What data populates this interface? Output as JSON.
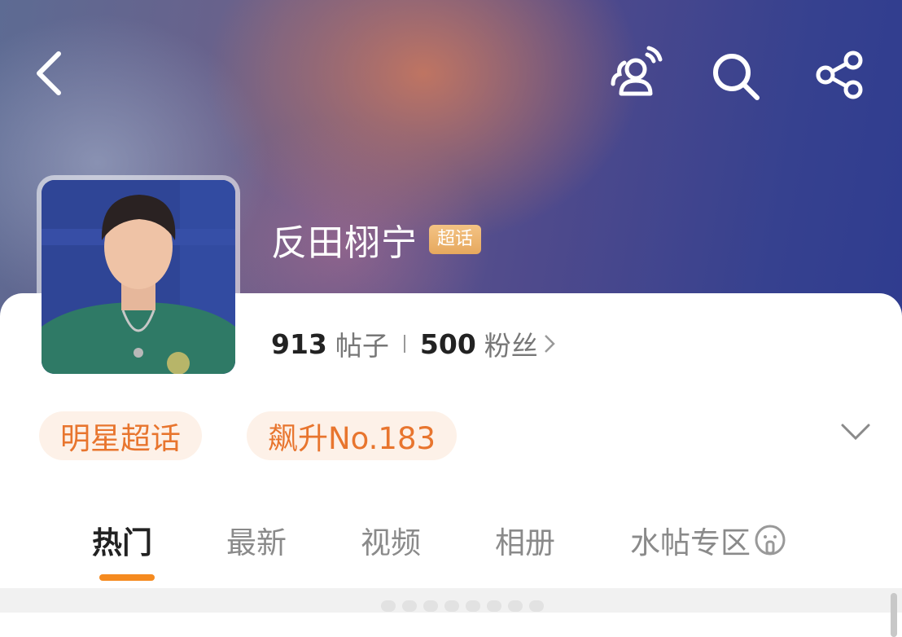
{
  "header": {
    "back_icon": "chevron-left-icon",
    "actions": [
      "people-broadcast-icon",
      "search-icon",
      "share-icon"
    ]
  },
  "topic": {
    "name": "反田栩宁",
    "badge": "超话",
    "posts_count": "913",
    "posts_label": "帖子",
    "fans_count": "500",
    "fans_label": "粉丝"
  },
  "tags": [
    "明星超话",
    "飙升No.183"
  ],
  "tabs": [
    {
      "label": "热门",
      "active": true
    },
    {
      "label": "最新"
    },
    {
      "label": "视频"
    },
    {
      "label": "相册"
    },
    {
      "label": "水帖专区"
    }
  ],
  "colors": {
    "accent": "#f58a1f",
    "chip_text": "#e8752e",
    "chip_bg": "#fdf1e8",
    "badge": "#e6a85e"
  }
}
